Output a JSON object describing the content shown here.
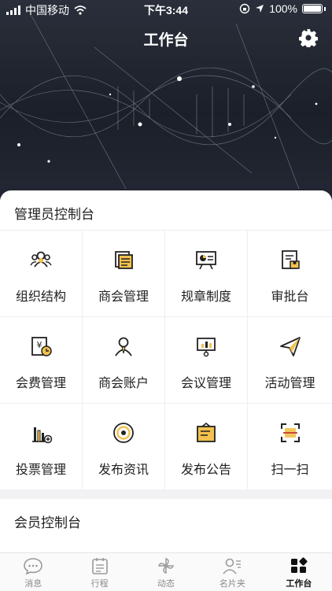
{
  "status_bar": {
    "carrier": "中国移动",
    "time": "下午3:44",
    "battery": "100%"
  },
  "nav": {
    "title": "工作台"
  },
  "admin_section": {
    "title": "管理员控制台",
    "items": [
      {
        "label": "组织结构",
        "icon": "people-icon"
      },
      {
        "label": "商会管理",
        "icon": "document-stack-icon"
      },
      {
        "label": "规章制度",
        "icon": "presentation-board-icon"
      },
      {
        "label": "审批台",
        "icon": "approval-icon"
      },
      {
        "label": "会费管理",
        "icon": "fee-icon"
      },
      {
        "label": "商会账户",
        "icon": "account-icon"
      },
      {
        "label": "会议管理",
        "icon": "meeting-icon"
      },
      {
        "label": "活动管理",
        "icon": "paper-plane-icon"
      },
      {
        "label": "投票管理",
        "icon": "bar-chart-plus-icon"
      },
      {
        "label": "发布资讯",
        "icon": "target-icon"
      },
      {
        "label": "发布公告",
        "icon": "notice-board-icon"
      },
      {
        "label": "扫一扫",
        "icon": "scan-icon"
      }
    ]
  },
  "member_section": {
    "title": "会员控制台"
  },
  "tabbar": {
    "items": [
      {
        "label": "消息",
        "icon": "chat-bubble-icon"
      },
      {
        "label": "行程",
        "icon": "calendar-icon"
      },
      {
        "label": "动态",
        "icon": "pinwheel-icon"
      },
      {
        "label": "名片夹",
        "icon": "contact-card-icon"
      },
      {
        "label": "工作台",
        "icon": "workbench-icon"
      }
    ],
    "active_index": 4
  },
  "colors": {
    "accent_yellow": "#f2c14e",
    "icon_dark": "#222222"
  }
}
